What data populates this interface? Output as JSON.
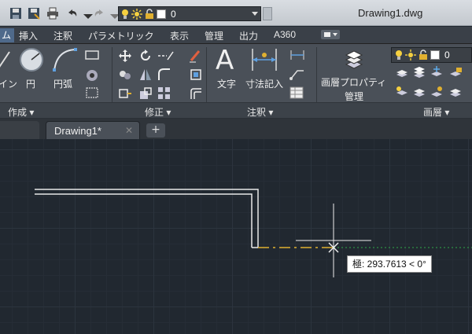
{
  "window": {
    "title": "Drawing1.dwg"
  },
  "quick_access": {
    "layer_combo": {
      "value": "0"
    },
    "icons": [
      "save-icon",
      "saveas-icon",
      "print-icon",
      "undo-icon",
      "redo-icon"
    ]
  },
  "ribbon_tabs": [
    {
      "label": "ム",
      "active": true
    },
    {
      "label": "挿入"
    },
    {
      "label": "注釈"
    },
    {
      "label": "パラメトリック"
    },
    {
      "label": "表示"
    },
    {
      "label": "管理"
    },
    {
      "label": "出力"
    },
    {
      "label": "A360"
    }
  ],
  "panels": {
    "create": {
      "title": "作成",
      "tools": [
        {
          "label": "イン"
        },
        {
          "label": "円"
        },
        {
          "label": "円弧"
        }
      ]
    },
    "modify": {
      "title": "修正"
    },
    "annotation": {
      "title": "注釈",
      "tools": [
        {
          "label": "文字"
        },
        {
          "label": "寸法記入"
        }
      ]
    },
    "layers": {
      "title": "画層",
      "properties_label_1": "画層プロパティ",
      "properties_label_2": "管理",
      "layer_value": "0"
    }
  },
  "document_tabs": [
    {
      "label": "Drawing1*",
      "active": true
    }
  ],
  "new_tab_label": "+",
  "cursor_tooltip": {
    "text": "極: 293.7613 < 0°"
  },
  "colors": {
    "canvas_bg": "#212830",
    "ribbon_bg": "#4a5058",
    "active_tab": "#4f6a8b",
    "tracking_line": "#2ea84a",
    "rubber_band": "#e0b030"
  }
}
